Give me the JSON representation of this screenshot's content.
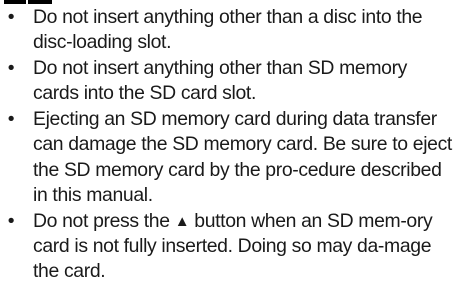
{
  "notes": [
    {
      "bullet": "•",
      "text": "Do not insert anything other than a disc into the disc-loading slot."
    },
    {
      "bullet": "•",
      "text": "Do not insert anything other than SD memory cards into the SD card slot."
    },
    {
      "bullet": "•",
      "text": "Ejecting an SD memory card during data transfer can damage the SD memory card. Be sure to eject the SD memory card by the pro-cedure described in this manual."
    },
    {
      "bullet": "•",
      "text_before": "Do not press the ",
      "button_symbol": "▲",
      "text_after": " button when an SD mem-ory card is not fully inserted. Doing so may da-mage the card."
    }
  ]
}
